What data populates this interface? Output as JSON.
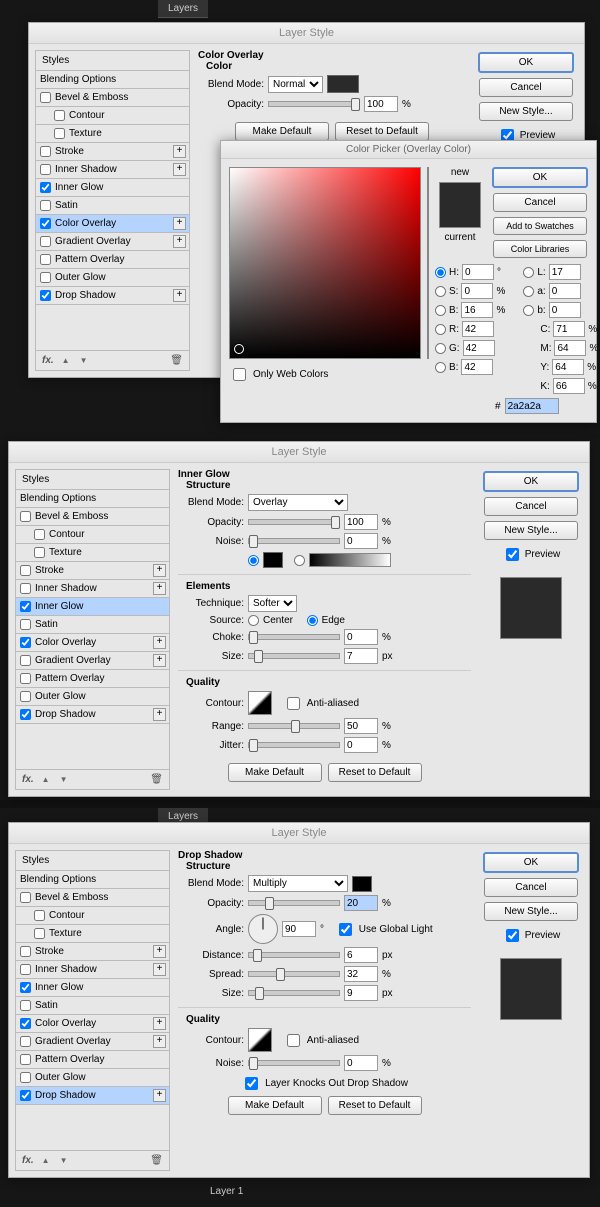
{
  "layers_tab": "Layers",
  "dialog1": {
    "title": "Layer Style",
    "styles_header": "Styles",
    "blending": "Blending Options",
    "items": [
      {
        "label": "Bevel & Emboss",
        "checked": false,
        "plus": false
      },
      {
        "label": "Contour",
        "checked": false,
        "indent": true
      },
      {
        "label": "Texture",
        "checked": false,
        "indent": true
      },
      {
        "label": "Stroke",
        "checked": false,
        "plus": true
      },
      {
        "label": "Inner Shadow",
        "checked": false,
        "plus": true
      },
      {
        "label": "Inner Glow",
        "checked": true
      },
      {
        "label": "Satin",
        "checked": false
      },
      {
        "label": "Color Overlay",
        "checked": true,
        "plus": true,
        "sel": true
      },
      {
        "label": "Gradient Overlay",
        "checked": false,
        "plus": true
      },
      {
        "label": "Pattern Overlay",
        "checked": false
      },
      {
        "label": "Outer Glow",
        "checked": false
      },
      {
        "label": "Drop Shadow",
        "checked": true,
        "plus": true
      }
    ],
    "panel": {
      "title": "Color Overlay",
      "sub": "Color",
      "blend_label": "Blend Mode:",
      "blend_value": "Normal",
      "swatch": "#2a2a2a",
      "opacity_label": "Opacity:",
      "opacity": "100",
      "opacity_unit": "%",
      "make_default": "Make Default",
      "reset_default": "Reset to Default"
    },
    "buttons": {
      "ok": "OK",
      "cancel": "Cancel",
      "newstyle": "New Style...",
      "preview": "Preview"
    }
  },
  "picker": {
    "title": "Color Picker (Overlay Color)",
    "new": "new",
    "cur": "current",
    "only_web": "Only Web Colors",
    "ok": "OK",
    "cancel": "Cancel",
    "add": "Add to Swatches",
    "lib": "Color Libraries",
    "H": "0",
    "S": "0",
    "Bh": "16",
    "R": "42",
    "G": "42",
    "B": "42",
    "L": "17",
    "a": "0",
    "b": "0",
    "C": "71",
    "M": "64",
    "Y": "64",
    "K": "66",
    "deg": "°",
    "pct": "%",
    "hex": "2a2a2a",
    "new_c": "#2a2a2a",
    "cur_c": "#2a2a2a"
  },
  "dialog2": {
    "title": "Layer Style",
    "sel": "Inner Glow",
    "panel": {
      "title": "Inner Glow",
      "sub1": "Structure",
      "blend_label": "Blend Mode:",
      "blend_value": "Overlay",
      "opacity_label": "Opacity:",
      "opacity": "100",
      "pct": "%",
      "noise_label": "Noise:",
      "noise": "0",
      "sub2": "Elements",
      "tech_label": "Technique:",
      "tech": "Softer",
      "source_label": "Source:",
      "src_center": "Center",
      "src_edge": "Edge",
      "choke_label": "Choke:",
      "choke": "0",
      "size_label": "Size:",
      "size": "7",
      "px": "px",
      "sub3": "Quality",
      "contour_label": "Contour:",
      "aa": "Anti-aliased",
      "range_label": "Range:",
      "range": "50",
      "jitter_label": "Jitter:",
      "jitter": "0",
      "make_default": "Make Default",
      "reset_default": "Reset to Default"
    }
  },
  "dialog3": {
    "title": "Layer Style",
    "sel": "Drop Shadow",
    "panel": {
      "title": "Drop Shadow",
      "sub1": "Structure",
      "blend_label": "Blend Mode:",
      "blend_value": "Multiply",
      "swatch": "#000000",
      "opacity_label": "Opacity:",
      "opacity": "20",
      "pct": "%",
      "angle_label": "Angle:",
      "angle": "90",
      "deg": "°",
      "ugl": "Use Global Light",
      "dist_label": "Distance:",
      "dist": "6",
      "px": "px",
      "spread_label": "Spread:",
      "spread": "32",
      "size_label": "Size:",
      "size": "9",
      "sub2": "Quality",
      "contour_label": "Contour:",
      "aa": "Anti-aliased",
      "noise_label": "Noise:",
      "noise": "0",
      "knock": "Layer Knocks Out Drop Shadow",
      "make_default": "Make Default",
      "reset_default": "Reset to Default"
    }
  },
  "layer_label": "Layer 1",
  "fx": "fx."
}
